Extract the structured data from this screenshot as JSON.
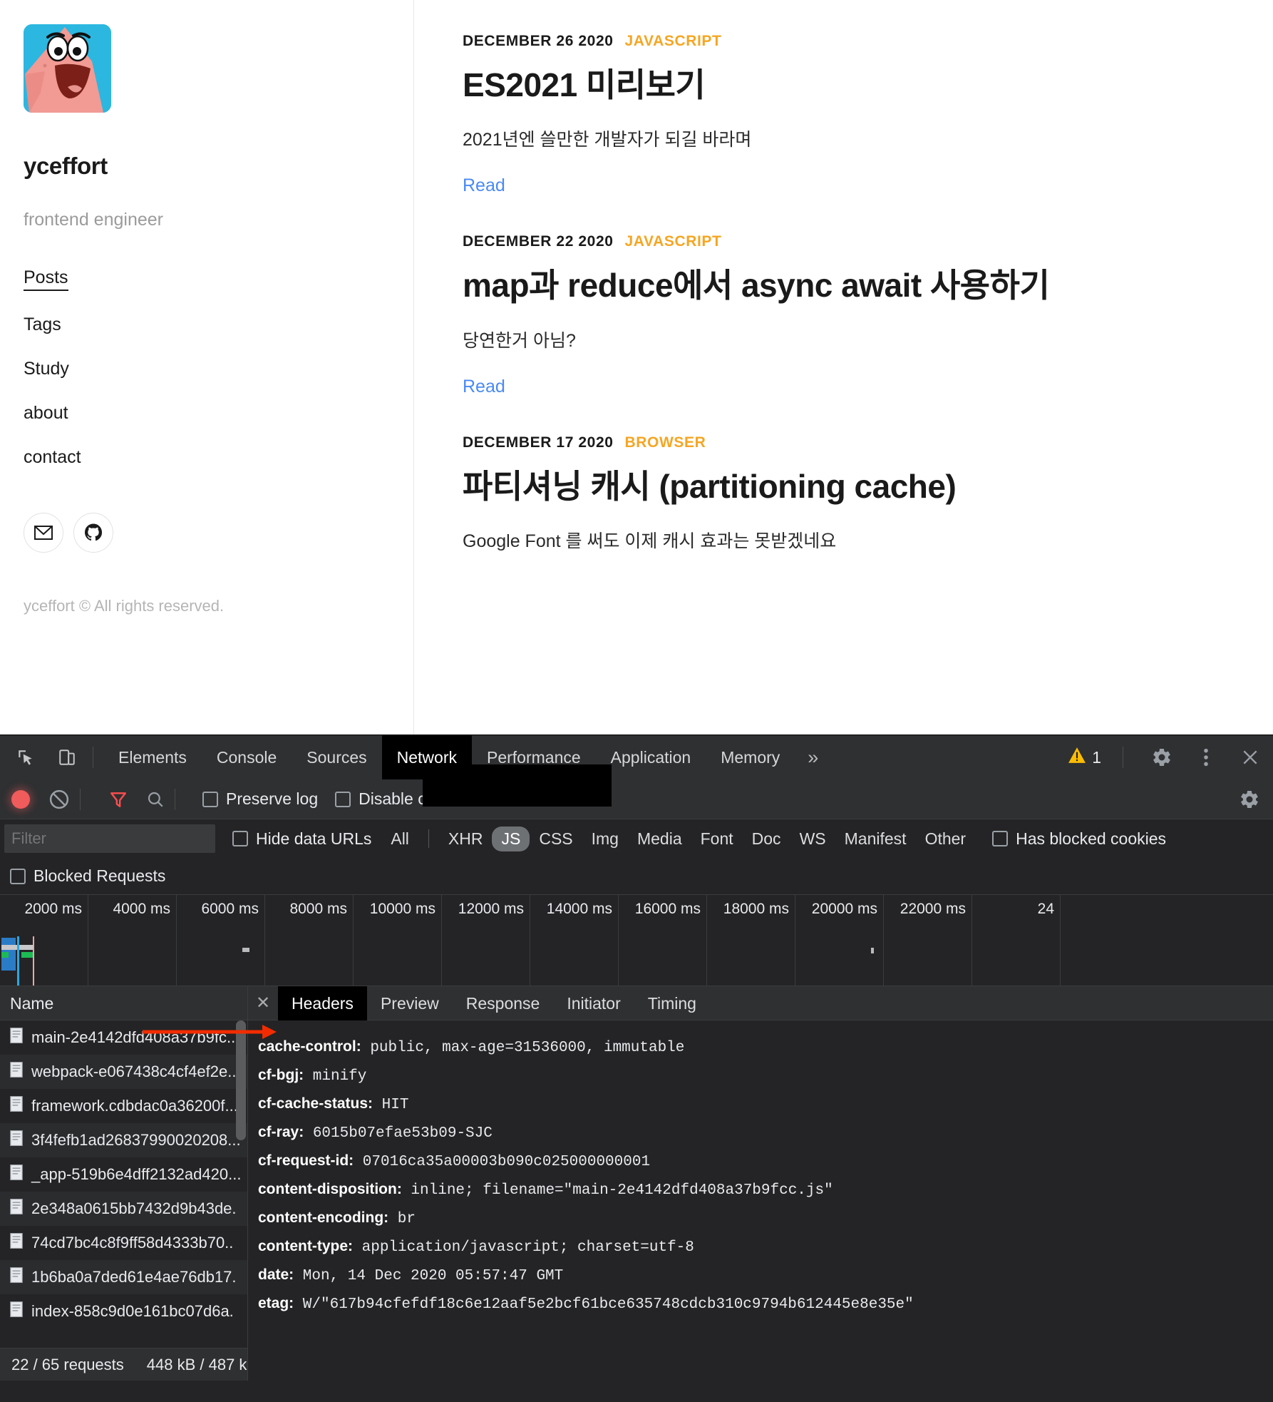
{
  "blog": {
    "profile": {
      "avatar_alt": "patrick-star-avatar",
      "name": "yceffort",
      "role": "frontend engineer"
    },
    "nav": [
      {
        "label": "Posts",
        "active": true
      },
      {
        "label": "Tags",
        "active": false
      },
      {
        "label": "Study",
        "active": false
      },
      {
        "label": "about",
        "active": false
      },
      {
        "label": "contact",
        "active": false
      }
    ],
    "socials": [
      {
        "name": "mail-icon"
      },
      {
        "name": "github-icon"
      }
    ],
    "footer": "yceffort © All rights reserved.",
    "read_label": "Read",
    "posts": [
      {
        "date": "DECEMBER 26 2020",
        "tag": "JAVASCRIPT",
        "title": "ES2021 미리보기",
        "excerpt": "2021년엔 쓸만한 개발자가 되길 바라며"
      },
      {
        "date": "DECEMBER 22 2020",
        "tag": "JAVASCRIPT",
        "title": "map과 reduce에서 async await 사용하기",
        "excerpt": "당연한거 아님?"
      },
      {
        "date": "DECEMBER 17 2020",
        "tag": "BROWSER",
        "title": "파티셔닝 캐시 (partitioning cache)",
        "excerpt": "Google Font 를 써도 이제 캐시 효과는 못받겠네요"
      }
    ],
    "accent_tag_color": "#f5a623",
    "link_color": "#4a8af4"
  },
  "devtools": {
    "main_tabs": [
      {
        "label": "Elements",
        "selected": false
      },
      {
        "label": "Console",
        "selected": false
      },
      {
        "label": "Sources",
        "selected": false
      },
      {
        "label": "Network",
        "selected": true
      },
      {
        "label": "Performance",
        "selected": false
      },
      {
        "label": "Application",
        "selected": false
      },
      {
        "label": "Memory",
        "selected": false
      }
    ],
    "more_tabs_label": "»",
    "inspect_icon": "inspect-element-icon",
    "device_icon": "device-toolbar-icon",
    "warning_count": "1",
    "settings_icon": "gear-icon",
    "more_options_icon": "kebab-menu-icon",
    "close_icon": "close-icon",
    "network_toolbar": {
      "record_label": "record-button",
      "clear_label": "clear-button",
      "filter_label": "filter-button",
      "search_label": "search-button",
      "preserve_log": "Preserve log",
      "disable_cache": "Disable cache",
      "settings_icon": "network-settings-gear-icon"
    },
    "filter_row": {
      "filter_placeholder": "Filter",
      "hide_data_urls": "Hide data URLs",
      "types": [
        {
          "label": "All",
          "on": false
        },
        {
          "label": "XHR",
          "on": false
        },
        {
          "label": "JS",
          "on": true
        },
        {
          "label": "CSS",
          "on": false
        },
        {
          "label": "Img",
          "on": false
        },
        {
          "label": "Media",
          "on": false
        },
        {
          "label": "Font",
          "on": false
        },
        {
          "label": "Doc",
          "on": false
        },
        {
          "label": "WS",
          "on": false
        },
        {
          "label": "Manifest",
          "on": false
        },
        {
          "label": "Other",
          "on": false
        }
      ],
      "has_blocked_cookies": "Has blocked cookies",
      "blocked_requests": "Blocked Requests"
    },
    "overview_ticks": [
      "2000 ms",
      "4000 ms",
      "6000 ms",
      "8000 ms",
      "10000 ms",
      "12000 ms",
      "14000 ms",
      "16000 ms",
      "18000 ms",
      "20000 ms",
      "22000 ms",
      "24"
    ],
    "requests": {
      "column_header": "Name",
      "rows": [
        "main-2e4142dfd408a37b9fc...",
        "webpack-e067438c4cf4ef2e...",
        "framework.cdbdac0a36200f...",
        "3f4fefb1ad26837990020208...",
        "_app-519b6e4dff2132ad420...",
        "2e348a0615bb7432d9b43de.",
        "74cd7bc4c8f9ff58d4333b70..",
        "1b6ba0a7ded61e4ae76db17.",
        "index-858c9d0e161bc07d6a."
      ]
    },
    "status": {
      "requests": "22 / 65 requests",
      "transferred": "448 kB / 487 k"
    },
    "detail_tabs": [
      {
        "label": "Headers",
        "selected": true
      },
      {
        "label": "Preview",
        "selected": false
      },
      {
        "label": "Response",
        "selected": false
      },
      {
        "label": "Initiator",
        "selected": false
      },
      {
        "label": "Timing",
        "selected": false
      }
    ],
    "headers": [
      {
        "name": "cache-control:",
        "value": "public, max-age=31536000, immutable"
      },
      {
        "name": "cf-bgj:",
        "value": "minify"
      },
      {
        "name": "cf-cache-status:",
        "value": "HIT"
      },
      {
        "name": "cf-ray:",
        "value": "6015b07efae53b09-SJC"
      },
      {
        "name": "cf-request-id:",
        "value": "07016ca35a00003b090c025000000001"
      },
      {
        "name": "content-disposition:",
        "value": "inline; filename=\"main-2e4142dfd408a37b9fcc.js\""
      },
      {
        "name": "content-encoding:",
        "value": "br"
      },
      {
        "name": "content-type:",
        "value": "application/javascript; charset=utf-8"
      },
      {
        "name": "date:",
        "value": "Mon, 14 Dec 2020 05:57:47 GMT"
      },
      {
        "name": "etag:",
        "value": "W/\"617b94cfefdf18c6e12aaf5e2bcf61bce635748cdcb310c9794b612445e8e35e\""
      }
    ],
    "annotation": {
      "name": "red-arrow-annotation",
      "points_to": "content-encoding:",
      "color": "#f22c00"
    }
  }
}
